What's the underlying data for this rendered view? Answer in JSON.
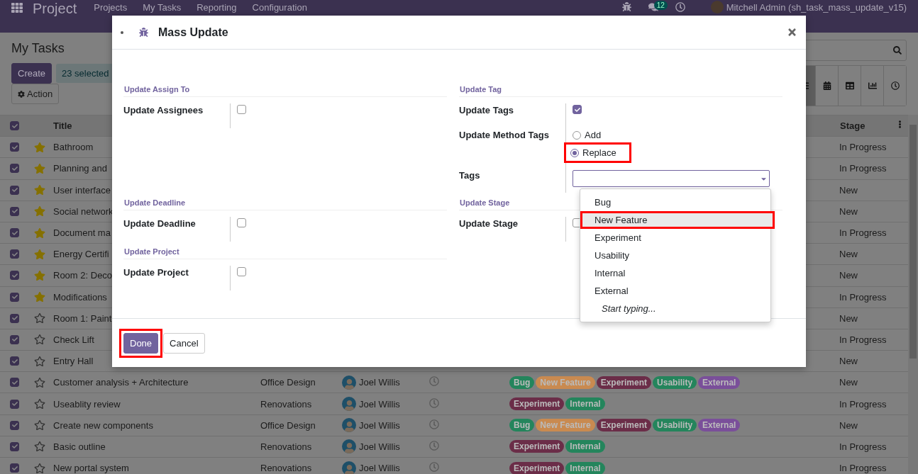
{
  "navbar": {
    "app_name": "Project",
    "menu": [
      "Projects",
      "My Tasks",
      "Reporting",
      "Configuration"
    ],
    "message_count": "12",
    "user": "Mitchell Admin (sh_task_mass_update_v15)"
  },
  "control_panel": {
    "title": "My Tasks",
    "create_button": "Create",
    "selection_badge": "23 selected",
    "action_button": "Action",
    "views": [
      {
        "kind": "list",
        "selected": true
      },
      {
        "kind": "calendar",
        "selected": false
      },
      {
        "kind": "pivot",
        "selected": false
      },
      {
        "kind": "graph",
        "selected": false
      },
      {
        "kind": "activity",
        "selected": false
      }
    ]
  },
  "table": {
    "header_checked": true,
    "columns": [
      "Title",
      "Stage"
    ],
    "rows": [
      {
        "checked": true,
        "starred": true,
        "title": "Bathroom",
        "stage": "In Progress"
      },
      {
        "checked": true,
        "starred": true,
        "title": "Planning and",
        "stage": "In Progress"
      },
      {
        "checked": true,
        "starred": true,
        "title": "User interface",
        "stage": "New"
      },
      {
        "checked": true,
        "starred": true,
        "title": "Social network",
        "stage": "New"
      },
      {
        "checked": true,
        "starred": true,
        "title": "Document ma",
        "stage": "In Progress"
      },
      {
        "checked": true,
        "starred": true,
        "title": "Energy Certifi",
        "stage": "New"
      },
      {
        "checked": true,
        "starred": true,
        "title": "Room 2: Deco",
        "stage": "New"
      },
      {
        "checked": true,
        "starred": true,
        "title": "Modifications",
        "stage": "In Progress"
      },
      {
        "checked": true,
        "starred": false,
        "title": "Room 1: Paint",
        "stage": "New"
      },
      {
        "checked": true,
        "starred": false,
        "title": "Check Lift",
        "stage": "In Progress"
      },
      {
        "checked": true,
        "starred": false,
        "title": "Entry Hall",
        "stage": "New"
      },
      {
        "checked": true,
        "starred": false,
        "title": "Customer analysis + Architecture",
        "project": "Office Design",
        "assignee": "Joel Willis",
        "tags": [
          {
            "label": "Bug",
            "color": "#24855c"
          },
          {
            "label": "New Feature",
            "color": "#c98a50"
          },
          {
            "label": "Experiment",
            "color": "#6b2d48"
          },
          {
            "label": "Usability",
            "color": "#24855c"
          },
          {
            "label": "External",
            "color": "#7a4f9a"
          }
        ],
        "stage": "New"
      },
      {
        "checked": true,
        "starred": false,
        "title": "Useablity review",
        "project": "Renovations",
        "assignee": "Joel Willis",
        "tags": [
          {
            "label": "Experiment",
            "color": "#6b2d48"
          },
          {
            "label": "Internal",
            "color": "#24855c"
          }
        ],
        "stage": "In Progress"
      },
      {
        "checked": true,
        "starred": false,
        "title": "Create new components",
        "project": "Office Design",
        "assignee": "Joel Willis",
        "tags": [
          {
            "label": "Bug",
            "color": "#24855c"
          },
          {
            "label": "New Feature",
            "color": "#c98a50"
          },
          {
            "label": "Experiment",
            "color": "#6b2d48"
          },
          {
            "label": "Usability",
            "color": "#24855c"
          },
          {
            "label": "External",
            "color": "#7a4f9a"
          }
        ],
        "stage": "New"
      },
      {
        "checked": true,
        "starred": false,
        "title": "Basic outline",
        "project": "Renovations",
        "assignee": "Joel Willis",
        "tags": [
          {
            "label": "Experiment",
            "color": "#6b2d48"
          },
          {
            "label": "Internal",
            "color": "#24855c"
          }
        ],
        "stage": "In Progress"
      },
      {
        "checked": true,
        "starred": false,
        "title": "New portal system",
        "project": "Renovations",
        "assignee": "Joel Willis",
        "tags": [
          {
            "label": "Experiment",
            "color": "#6b2d48"
          },
          {
            "label": "Internal",
            "color": "#24855c"
          }
        ],
        "stage": "In Progress"
      }
    ]
  },
  "dialog": {
    "title": "Mass Update",
    "sections": [
      {
        "title": "Update Assign To",
        "fields": [
          {
            "kind": "checkbox",
            "label": "Update Assignees",
            "checked": false
          }
        ]
      },
      {
        "title": "Update Tag",
        "fields": [
          {
            "kind": "checkbox",
            "label": "Update Tags",
            "checked": true
          },
          {
            "kind": "radio",
            "label": "Update Method Tags",
            "options": [
              {
                "label": "Add",
                "selected": false,
                "highlighted": false
              },
              {
                "label": "Replace",
                "selected": true,
                "highlighted": true
              }
            ]
          },
          {
            "kind": "select",
            "label": "Tags",
            "open": true,
            "options": [
              {
                "label": "Bug",
                "selected": false,
                "highlighted": false
              },
              {
                "label": "New Feature",
                "selected": true,
                "highlighted": true
              },
              {
                "label": "Experiment",
                "selected": false,
                "highlighted": false
              },
              {
                "label": "Usability",
                "selected": false,
                "highlighted": false
              },
              {
                "label": "Internal",
                "selected": false,
                "highlighted": false
              },
              {
                "label": "External",
                "selected": false,
                "highlighted": false
              }
            ],
            "hint": "Start typing..."
          }
        ]
      },
      {
        "title": "Update Deadline",
        "fields": [
          {
            "kind": "checkbox",
            "label": "Update Deadline",
            "checked": false
          }
        ]
      },
      {
        "title": "Update Stage",
        "fields": [
          {
            "kind": "checkbox",
            "label": "Update Stage",
            "checked": false
          }
        ]
      },
      {
        "title": "Update Project",
        "fields": [
          {
            "kind": "checkbox",
            "label": "Update Project",
            "checked": false
          }
        ]
      }
    ],
    "buttons": [
      {
        "label": "Done",
        "kind": "primary",
        "highlighted": true
      },
      {
        "label": "Cancel",
        "kind": "secondary",
        "highlighted": false
      }
    ]
  }
}
